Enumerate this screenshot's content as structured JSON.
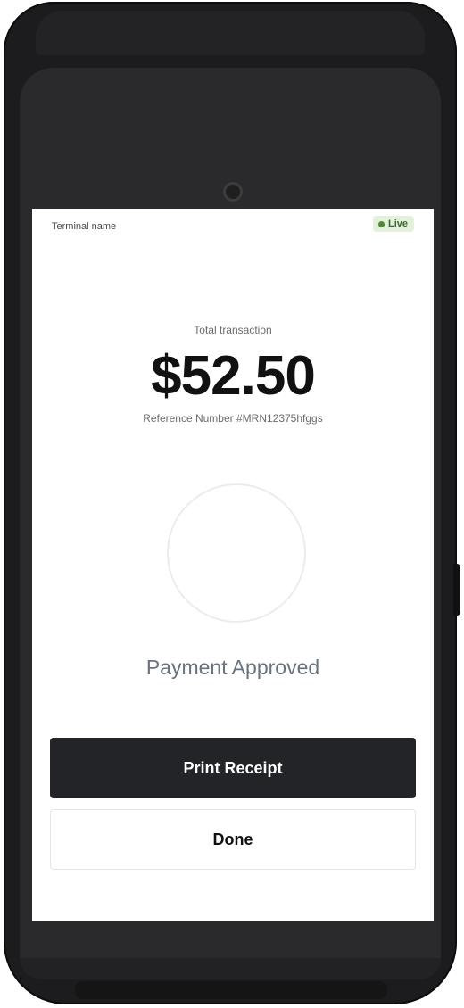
{
  "header": {
    "terminal_name": "Terminal name",
    "status_badge": "Live"
  },
  "transaction": {
    "total_label": "Total transaction",
    "amount": "$52.50",
    "reference": "Reference Number #MRN12375hfggs"
  },
  "payment": {
    "status": "Payment Approved"
  },
  "actions": {
    "print_label": "Print Receipt",
    "done_label": "Done"
  },
  "colors": {
    "live_badge_bg": "#e3f1dc",
    "live_dot": "#4c8a35",
    "primary_button": "#232428"
  }
}
